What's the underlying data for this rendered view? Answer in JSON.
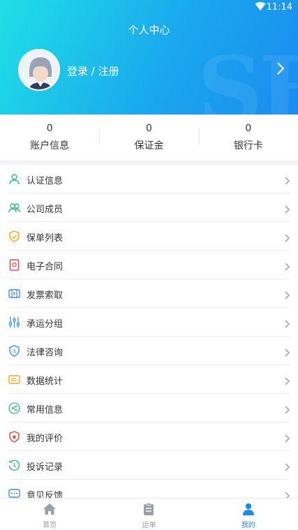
{
  "status_bar": {
    "time": "11:14"
  },
  "header": {
    "title": "个人中心",
    "login_label": "登录 / 注册",
    "watermark": "SF"
  },
  "stats": [
    {
      "value": "0",
      "label": "账户信息"
    },
    {
      "value": "0",
      "label": "保证金"
    },
    {
      "value": "0",
      "label": "银行卡"
    }
  ],
  "menu": [
    {
      "label": "认证信息",
      "icon": "user-icon",
      "color": "#2bbf8a"
    },
    {
      "label": "公司成员",
      "icon": "members-icon",
      "color": "#2bbf8a"
    },
    {
      "label": "保单列表",
      "icon": "shield-check-icon",
      "color": "#f5a623"
    },
    {
      "label": "电子合同",
      "icon": "contract-icon",
      "color": "#e64545"
    },
    {
      "label": "发票索取",
      "icon": "invoice-icon",
      "color": "#3a8ee6"
    },
    {
      "label": "承运分组",
      "icon": "sliders-icon",
      "color": "#3a8ee6"
    },
    {
      "label": "法律咨询",
      "icon": "law-icon",
      "color": "#3a8ee6"
    },
    {
      "label": "数据统计",
      "icon": "stats-icon",
      "color": "#f5a623"
    },
    {
      "label": "常用信息",
      "icon": "share-icon",
      "color": "#2bbf8a"
    },
    {
      "label": "我的评价",
      "icon": "review-icon",
      "color": "#e64545"
    },
    {
      "label": "投诉记录",
      "icon": "history-icon",
      "color": "#2bbf8a"
    },
    {
      "label": "意见反馈",
      "icon": "feedback-icon",
      "color": "#3a8ee6"
    }
  ],
  "tabs": [
    {
      "label": "首页",
      "icon": "home-icon",
      "active": false
    },
    {
      "label": "运单",
      "icon": "clipboard-icon",
      "active": false
    },
    {
      "label": "我的",
      "icon": "person-icon",
      "active": true
    }
  ],
  "colors": {
    "accent": "#1a8cf0",
    "header_start": "#1fe0e6"
  }
}
